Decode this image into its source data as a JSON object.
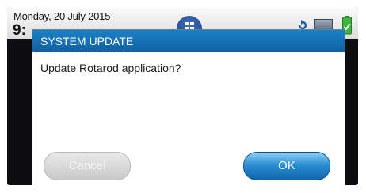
{
  "status_bar": {
    "date": "Monday, 20 July 2015",
    "time_partial": "9:",
    "icons": [
      "home-icon",
      "refresh-icon",
      "monitor-icon",
      "battery-icon"
    ]
  },
  "dialog": {
    "title": "SYSTEM UPDATE",
    "message": "Update Rotarod application?",
    "cancel_label": "Cancel",
    "ok_label": "OK"
  },
  "colors": {
    "header_blue": "#1b80c5",
    "ok_button_blue": "#2b8fd3",
    "battery_green": "#3fb53f"
  }
}
